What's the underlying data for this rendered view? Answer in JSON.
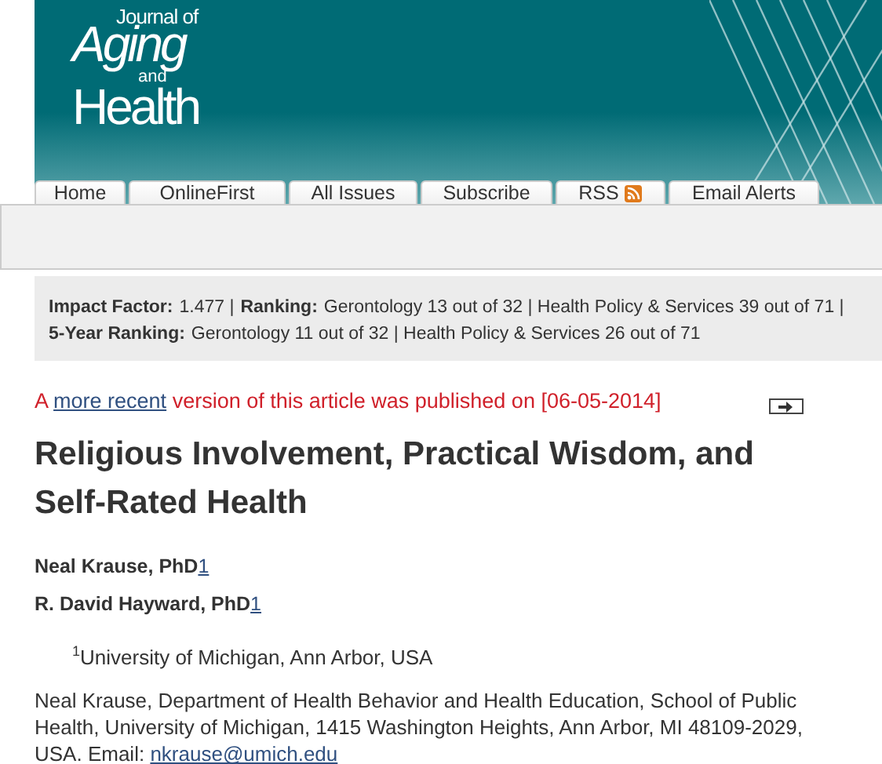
{
  "header": {
    "logo": [
      "Journal of",
      "Aging",
      "and",
      "Health"
    ]
  },
  "tabs": [
    {
      "label": "Home",
      "kind": "text"
    },
    {
      "label": "OnlineFirst",
      "kind": "text"
    },
    {
      "label": "All Issues",
      "kind": "text"
    },
    {
      "label": "Subscribe",
      "kind": "text"
    },
    {
      "label": "RSS",
      "kind": "feed"
    },
    {
      "label": "Email Alerts",
      "kind": "text"
    }
  ],
  "rankings": [
    {
      "parts": [
        {
          "label": "Impact Factor:",
          "text": "1.477 |"
        },
        {
          "label": "Ranking:",
          "text": "Gerontology 13 out of 32 | Health Policy & Services 39 out of 71 |"
        }
      ]
    },
    {
      "parts": [
        {
          "label": "5-Year Ranking:",
          "text": "Gerontology 11 out of 32 | Health Policy & Services 26 out of 71"
        }
      ]
    }
  ],
  "notice": {
    "prefix": "A",
    "link": "more recent",
    "suffix": "version of this article was published on [06-05-2014]"
  },
  "title": "Religious Involvement, Practical Wisdom, and Self-Rated Health",
  "authors": [
    {
      "name": "Neal Krause, PhD",
      "ref": "1"
    },
    {
      "name": "R. David Hayward, PhD",
      "ref": "1"
    }
  ],
  "affiliation": {
    "mark": "1",
    "text": "University of Michigan, Ann Arbor, USA"
  },
  "correspondence": {
    "text": "Neal Krause, Department of Health Behavior and Health Education, School of Public Health, University of Michigan, 1415 Washington Heights, Ann Arbor, MI 48109-2029, USA. Email:",
    "email": "nkrause@umich.edu"
  }
}
